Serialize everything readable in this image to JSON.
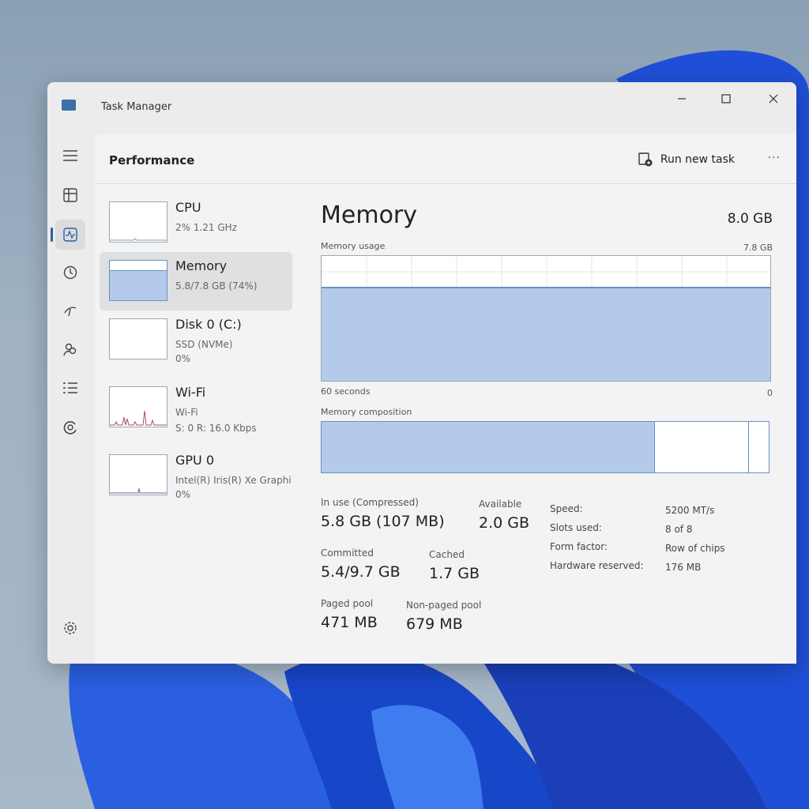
{
  "window": {
    "title": "Task Manager"
  },
  "header": {
    "page_title": "Performance",
    "run_new_task": "Run new task",
    "more": "..."
  },
  "nav": [
    {
      "name": "nav-menu",
      "icon": "hamburger-icon"
    },
    {
      "name": "nav-processes",
      "icon": "processes-icon"
    },
    {
      "name": "nav-performance",
      "icon": "performance-icon",
      "active": true
    },
    {
      "name": "nav-app-history",
      "icon": "history-icon"
    },
    {
      "name": "nav-startup-apps",
      "icon": "startup-icon"
    },
    {
      "name": "nav-users",
      "icon": "users-icon"
    },
    {
      "name": "nav-details",
      "icon": "details-icon"
    },
    {
      "name": "nav-services",
      "icon": "services-icon"
    }
  ],
  "resources": [
    {
      "name": "CPU",
      "line1": "2% 1.21 GHz",
      "line2": ""
    },
    {
      "name": "Memory",
      "line1": "5.8/7.8 GB (74%)",
      "line2": ""
    },
    {
      "name": "Disk 0 (C:)",
      "line1": "SSD (NVMe)",
      "line2": "0%"
    },
    {
      "name": "Wi-Fi",
      "line1": "Wi-Fi",
      "line2": "S: 0 R: 16.0 Kbps"
    },
    {
      "name": "GPU 0",
      "line1": "Intel(R) Iris(R) Xe Graphi",
      "line2": "0%"
    }
  ],
  "memory": {
    "title": "Memory",
    "total": "8.0 GB",
    "usage_label": "Memory usage",
    "usage_max": "7.8 GB",
    "usage_fraction": 0.74,
    "time_left": "60 seconds",
    "time_right": "0",
    "composition_label": "Memory composition",
    "composition_fractions": {
      "in_use": 0.745,
      "standby": 0.21,
      "free": 0.045
    },
    "stats": {
      "in_use_label": "In use (Compressed)",
      "in_use_value": "5.8 GB (107 MB)",
      "available_label": "Available",
      "available_value": "2.0 GB",
      "committed_label": "Committed",
      "committed_value": "5.4/9.7 GB",
      "cached_label": "Cached",
      "cached_value": "1.7 GB",
      "paged_label": "Paged pool",
      "paged_value": "471 MB",
      "nonpaged_label": "Non-paged pool",
      "nonpaged_value": "679 MB"
    },
    "specs": {
      "speed_label": "Speed:",
      "speed_value": "5200 MT/s",
      "slots_label": "Slots used:",
      "slots_value": "8 of 8",
      "form_label": "Form factor:",
      "form_value": "Row of chips",
      "reserved_label": "Hardware reserved:",
      "reserved_value": "176 MB"
    }
  },
  "colors": {
    "accent": "#2a5fa0",
    "memory_fill": "#b3caea",
    "memory_line": "#6a8ec4"
  }
}
